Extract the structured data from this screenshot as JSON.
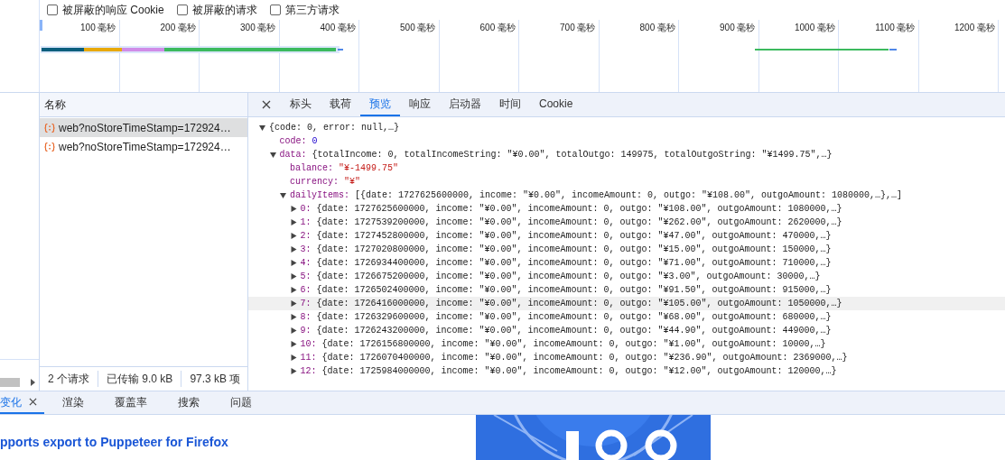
{
  "filters": [
    {
      "label": "被屏蔽的响应 Cookie",
      "checked": false
    },
    {
      "label": "被屏蔽的请求",
      "checked": false
    },
    {
      "label": "第三方请求",
      "checked": false
    }
  ],
  "timeline": {
    "ticks": [
      "100 毫秒",
      "200 毫秒",
      "300 毫秒",
      "400 毫秒",
      "500 毫秒",
      "600 毫秒",
      "700 毫秒",
      "800 毫秒",
      "900 毫秒",
      "1000 毫秒",
      "1100 毫秒",
      "1200 毫秒"
    ]
  },
  "requests": {
    "column": "名称",
    "rows": [
      {
        "name": "web?noStoreTimeStamp=172924…",
        "selected": true
      },
      {
        "name": "web?noStoreTimeStamp=172924…",
        "selected": false
      }
    ],
    "summary": [
      "2 个请求",
      "已传输 9.0 kB",
      "97.3 kB 项"
    ]
  },
  "detail_tabs": [
    {
      "label": "标头",
      "selected": false
    },
    {
      "label": "载荷",
      "selected": false
    },
    {
      "label": "预览",
      "selected": true
    },
    {
      "label": "响应",
      "selected": false
    },
    {
      "label": "启动器",
      "selected": false
    },
    {
      "label": "时间",
      "selected": false
    },
    {
      "label": "Cookie",
      "selected": false
    }
  ],
  "preview": {
    "tree": [
      {
        "kind": "object",
        "value": "{code: 0, error: null,…}",
        "expanded": true,
        "children": [
          {
            "key": "code:",
            "kind": "number",
            "value": "0"
          },
          {
            "key": "data:",
            "kind": "object",
            "value": "{totalIncome: 0, totalIncomeString: \"¥0.00\", totalOutgo: 149975, totalOutgoString: \"¥1499.75\",…}",
            "expanded": true,
            "children": [
              {
                "key": "balance:",
                "kind": "string",
                "value": "\"¥-1499.75\""
              },
              {
                "key": "currency:",
                "kind": "string",
                "value": "\"¥\""
              },
              {
                "key": "dailyItems:",
                "kind": "object",
                "value": "[{date: 1727625600000, income: \"¥0.00\", incomeAmount: 0, outgo: \"¥108.00\", outgoAmount: 1080000,…},…]",
                "expanded": true,
                "children": [
                  {
                    "key": "0:",
                    "kind": "object",
                    "expanded": false,
                    "highlighted": false,
                    "value": "{date: 1727625600000, income: \"¥0.00\", incomeAmount: 0, outgo: \"¥108.00\", outgoAmount: 1080000,…}"
                  },
                  {
                    "key": "1:",
                    "kind": "object",
                    "expanded": false,
                    "highlighted": false,
                    "value": "{date: 1727539200000, income: \"¥0.00\", incomeAmount: 0, outgo: \"¥262.00\", outgoAmount: 2620000,…}"
                  },
                  {
                    "key": "2:",
                    "kind": "object",
                    "expanded": false,
                    "highlighted": false,
                    "value": "{date: 1727452800000, income: \"¥0.00\", incomeAmount: 0, outgo: \"¥47.00\", outgoAmount: 470000,…}"
                  },
                  {
                    "key": "3:",
                    "kind": "object",
                    "expanded": false,
                    "highlighted": false,
                    "value": "{date: 1727020800000, income: \"¥0.00\", incomeAmount: 0, outgo: \"¥15.00\", outgoAmount: 150000,…}"
                  },
                  {
                    "key": "4:",
                    "kind": "object",
                    "expanded": false,
                    "highlighted": false,
                    "value": "{date: 1726934400000, income: \"¥0.00\", incomeAmount: 0, outgo: \"¥71.00\", outgoAmount: 710000,…}"
                  },
                  {
                    "key": "5:",
                    "kind": "object",
                    "expanded": false,
                    "highlighted": false,
                    "value": "{date: 1726675200000, income: \"¥0.00\", incomeAmount: 0, outgo: \"¥3.00\", outgoAmount: 30000,…}"
                  },
                  {
                    "key": "6:",
                    "kind": "object",
                    "expanded": false,
                    "highlighted": false,
                    "value": "{date: 1726502400000, income: \"¥0.00\", incomeAmount: 0, outgo: \"¥91.50\", outgoAmount: 915000,…}"
                  },
                  {
                    "key": "7:",
                    "kind": "object",
                    "expanded": false,
                    "highlighted": true,
                    "value": "{date: 1726416000000, income: \"¥0.00\", incomeAmount: 0, outgo: \"¥105.00\", outgoAmount: 1050000,…}"
                  },
                  {
                    "key": "8:",
                    "kind": "object",
                    "expanded": false,
                    "highlighted": false,
                    "value": "{date: 1726329600000, income: \"¥0.00\", incomeAmount: 0, outgo: \"¥68.00\", outgoAmount: 680000,…}"
                  },
                  {
                    "key": "9:",
                    "kind": "object",
                    "expanded": false,
                    "highlighted": false,
                    "value": "{date: 1726243200000, income: \"¥0.00\", incomeAmount: 0, outgo: \"¥44.90\", outgoAmount: 449000,…}"
                  },
                  {
                    "key": "10:",
                    "kind": "object",
                    "expanded": false,
                    "highlighted": false,
                    "value": "{date: 1726156800000, income: \"¥0.00\", incomeAmount: 0, outgo: \"¥1.00\", outgoAmount: 10000,…}"
                  },
                  {
                    "key": "11:",
                    "kind": "object",
                    "expanded": false,
                    "highlighted": false,
                    "value": "{date: 1726070400000, income: \"¥0.00\", incomeAmount: 0, outgo: \"¥236.90\", outgoAmount: 2369000,…}"
                  },
                  {
                    "key": "12:",
                    "kind": "object",
                    "expanded": false,
                    "highlighted": false,
                    "value": "{date: 1725984000000, income: \"¥0.00\", incomeAmount: 0, outgo: \"¥12.00\", outgoAmount: 120000,…}"
                  }
                ]
              }
            ]
          }
        ]
      }
    ]
  },
  "drawer_tabs": [
    {
      "label": "变化",
      "selected": true,
      "closable": true
    },
    {
      "label": "渲染",
      "selected": false,
      "closable": false
    },
    {
      "label": "覆盖率",
      "selected": false,
      "closable": false
    },
    {
      "label": "搜索",
      "selected": false,
      "closable": false
    },
    {
      "label": "问题",
      "selected": false,
      "closable": false
    }
  ],
  "page": {
    "link": "pports export to Puppeteer for Firefox"
  }
}
